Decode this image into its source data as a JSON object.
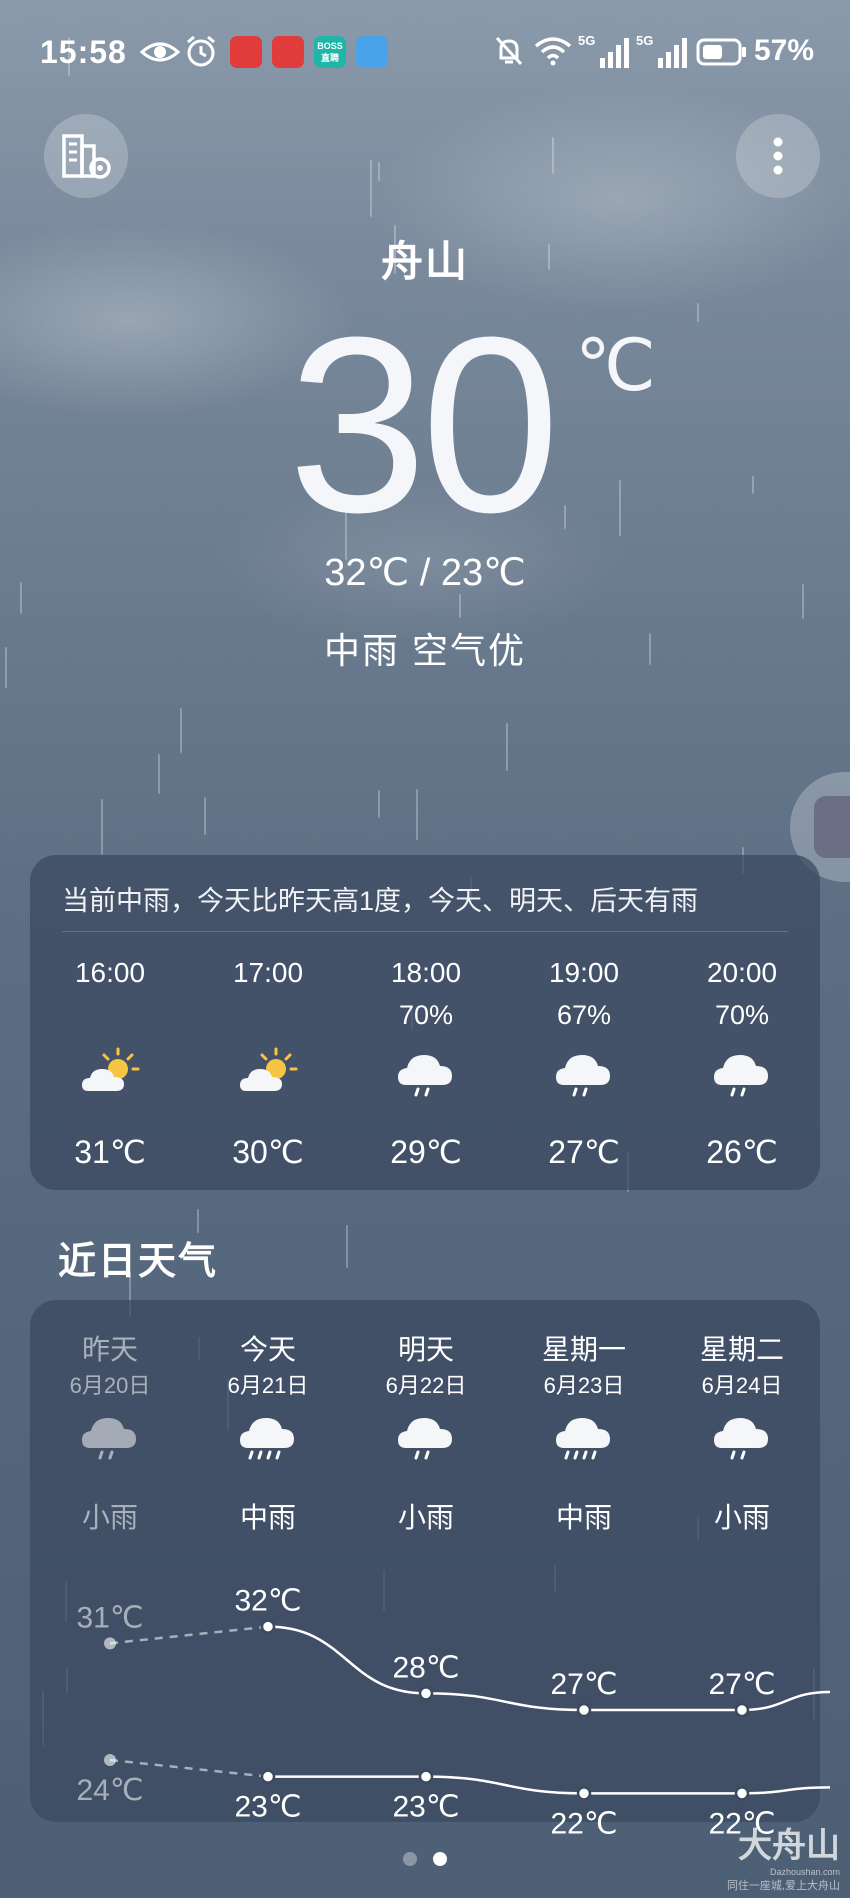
{
  "status_bar": {
    "time": "15:58",
    "network_badge": "5G",
    "battery": "57%",
    "app_badges": [
      {
        "name": "app-icon-618-a",
        "color": "#e23b3b"
      },
      {
        "name": "app-icon-618-b",
        "color": "#e23b3b"
      },
      {
        "name": "app-icon-boss",
        "color": "#1fb5a8",
        "text": "BOSS 直聘"
      },
      {
        "name": "app-icon-weather",
        "color": "#4aa3e8"
      }
    ]
  },
  "header": {
    "city": "舟山",
    "current_temp": "30",
    "temp_unit": "℃",
    "temp_range": "32℃ / 23℃",
    "summary": "中雨  空气优"
  },
  "hourly": {
    "description": "当前中雨，今天比昨天高1度，今天、明天、后天有雨",
    "items": [
      {
        "time": "16:00",
        "precip": "",
        "icon": "partly-sunny-icon",
        "temp": "31℃"
      },
      {
        "time": "17:00",
        "precip": "",
        "icon": "partly-sunny-icon",
        "temp": "30℃"
      },
      {
        "time": "18:00",
        "precip": "70%",
        "icon": "light-rain-icon",
        "temp": "29℃"
      },
      {
        "time": "19:00",
        "precip": "67%",
        "icon": "light-rain-icon",
        "temp": "27℃"
      },
      {
        "time": "20:00",
        "precip": "70%",
        "icon": "light-rain-icon",
        "temp": "26℃"
      }
    ]
  },
  "daily": {
    "title": "近日天气",
    "days": [
      {
        "name": "昨天",
        "date": "6月20日",
        "icon": "light-rain-icon",
        "condition": "小雨",
        "past": true
      },
      {
        "name": "今天",
        "date": "6月21日",
        "icon": "moderate-rain-icon",
        "condition": "中雨",
        "past": false
      },
      {
        "name": "明天",
        "date": "6月22日",
        "icon": "light-rain-icon",
        "condition": "小雨",
        "past": false
      },
      {
        "name": "星期一",
        "date": "6月23日",
        "icon": "moderate-rain-icon",
        "condition": "中雨",
        "past": false
      },
      {
        "name": "星期二",
        "date": "6月24日",
        "icon": "light-rain-icon",
        "condition": "小雨",
        "past": false
      }
    ]
  },
  "chart_data": {
    "type": "line",
    "categories": [
      "昨天",
      "今天",
      "明天",
      "星期一",
      "星期二"
    ],
    "series": [
      {
        "values": [
          31,
          32,
          28,
          27,
          27
        ],
        "labels": [
          "31℃",
          "32℃",
          "28℃",
          "27℃",
          "27℃"
        ]
      },
      {
        "values": [
          24,
          23,
          23,
          22,
          22
        ],
        "labels": [
          "24℃",
          "23℃",
          "23℃",
          "22℃",
          "22℃"
        ]
      }
    ]
  },
  "pager": {
    "count": 2,
    "active": 1
  },
  "watermark": {
    "name": "大舟山",
    "url": "Dazhoushan.com",
    "slogan": "同住一座城,爱上大舟山"
  }
}
